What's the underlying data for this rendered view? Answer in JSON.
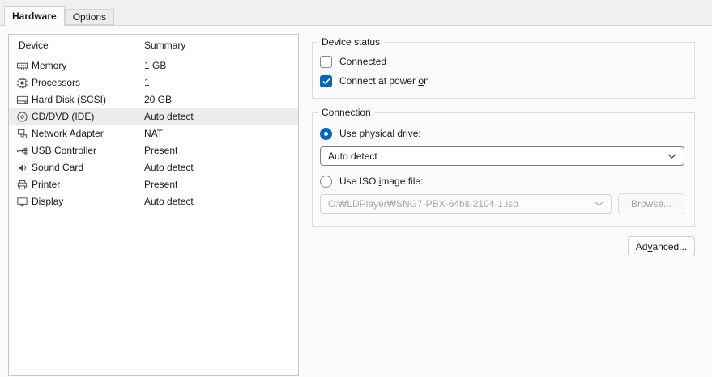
{
  "window": {
    "tabs": [
      {
        "label": "Hardware"
      },
      {
        "label": "Options"
      }
    ]
  },
  "device_list": {
    "header": {
      "device": "Device",
      "summary": "Summary"
    },
    "selected_index": 3,
    "rows": [
      {
        "icon": "memory-icon",
        "device": "Memory",
        "summary": "1 GB"
      },
      {
        "icon": "processor-icon",
        "device": "Processors",
        "summary": "1"
      },
      {
        "icon": "hard-disk-icon",
        "device": "Hard Disk (SCSI)",
        "summary": "20 GB"
      },
      {
        "icon": "cd-dvd-icon",
        "device": "CD/DVD (IDE)",
        "summary": "Auto detect"
      },
      {
        "icon": "network-adapter-icon",
        "device": "Network Adapter",
        "summary": "NAT"
      },
      {
        "icon": "usb-icon",
        "device": "USB Controller",
        "summary": "Present"
      },
      {
        "icon": "sound-icon",
        "device": "Sound Card",
        "summary": "Auto detect"
      },
      {
        "icon": "printer-icon",
        "device": "Printer",
        "summary": "Present"
      },
      {
        "icon": "display-icon",
        "device": "Display",
        "summary": "Auto detect"
      }
    ]
  },
  "device_status": {
    "title": "Device status",
    "connected": {
      "pre": "",
      "key": "C",
      "post": "onnected",
      "checked": false
    },
    "power_on": {
      "pre": "Connect at power ",
      "key": "o",
      "post": "n",
      "checked": true
    }
  },
  "connection": {
    "title": "Connection",
    "physical": {
      "label": "Use physical drive:",
      "selected": true,
      "value": "Auto detect"
    },
    "iso": {
      "pre": "Use ISO ",
      "key": "i",
      "post": "mage file:",
      "selected": false,
      "path": "C:₩LDPlayer₩SNG7-PBX-64bit-2104-1.iso"
    },
    "browse": {
      "label": "Browse...",
      "enabled": false
    }
  },
  "advanced": {
    "pre": "Ad",
    "key": "v",
    "post": "anced..."
  },
  "colors": {
    "accent": "#0067c0",
    "selected_row": "#ececec",
    "disabled_text": "#a6a6a6",
    "panel_background": "#fbfbfb"
  }
}
